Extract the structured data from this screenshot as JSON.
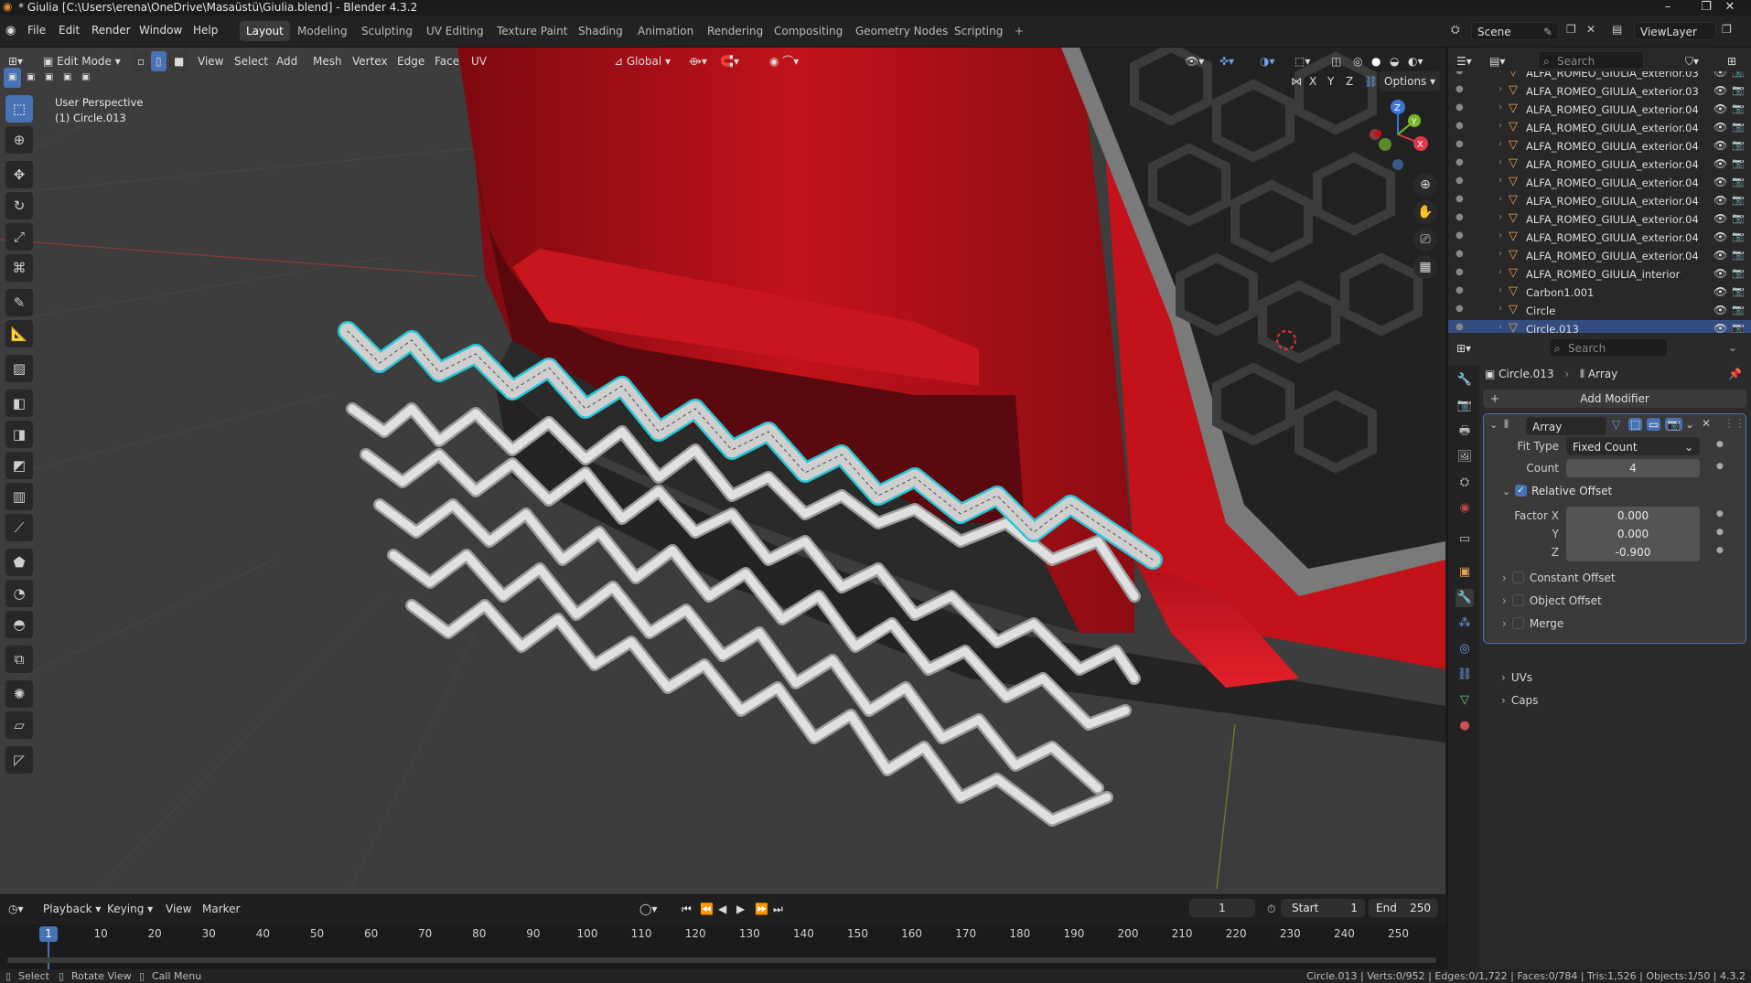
{
  "window": {
    "title": "* Giulia [C:\\Users\\erena\\OneDrive\\Masaüstü\\Giulia.blend] - Blender 4.3.2"
  },
  "menus": [
    "File",
    "Edit",
    "Render",
    "Window",
    "Help"
  ],
  "workspaces": [
    "Layout",
    "Modeling",
    "Sculpting",
    "UV Editing",
    "Texture Paint",
    "Shading",
    "Animation",
    "Rendering",
    "Compositing",
    "Geometry Nodes",
    "Scripting"
  ],
  "active_workspace": "Layout",
  "scene": {
    "label": "Scene",
    "view_layer": "ViewLayer"
  },
  "viewport": {
    "mode": "Edit Mode",
    "header_menus": [
      "View",
      "Select",
      "Add",
      "Mesh",
      "Vertex",
      "Edge",
      "Face",
      "UV"
    ],
    "orientation": "Global",
    "axes": [
      "X",
      "Y",
      "Z"
    ],
    "options": "Options",
    "overlay_text": {
      "line1": "User Perspective",
      "line2": "(1) Circle.013"
    },
    "gizmo": {
      "x": "X",
      "y": "Y",
      "z": "Z"
    }
  },
  "outliner": {
    "search_placeholder": "Search",
    "items": [
      "ALFA_ROMEO_GIULIA_exterior.03",
      "ALFA_ROMEO_GIULIA_exterior.03",
      "ALFA_ROMEO_GIULIA_exterior.04",
      "ALFA_ROMEO_GIULIA_exterior.04",
      "ALFA_ROMEO_GIULIA_exterior.04",
      "ALFA_ROMEO_GIULIA_exterior.04",
      "ALFA_ROMEO_GIULIA_exterior.04",
      "ALFA_ROMEO_GIULIA_exterior.04",
      "ALFA_ROMEO_GIULIA_exterior.04",
      "ALFA_ROMEO_GIULIA_exterior.04",
      "ALFA_ROMEO_GIULIA_exterior.04",
      "ALFA_ROMEO_GIULIA_interior",
      "Carbon1.001",
      "Circle",
      "Circle.013"
    ]
  },
  "properties": {
    "search_placeholder": "Search",
    "breadcrumb": {
      "object": "Circle.013",
      "modifier": "Array"
    },
    "add_modifier": "Add Modifier",
    "modifier": {
      "name": "Array",
      "fit_type_label": "Fit Type",
      "fit_type": "Fixed Count",
      "count_label": "Count",
      "count": "4",
      "relative_offset": "Relative Offset",
      "factor_x_label": "Factor X",
      "factor_x": "0.000",
      "y_label": "Y",
      "factor_y": "0.000",
      "z_label": "Z",
      "factor_z": "-0.900",
      "subpanels": [
        "Constant Offset",
        "Object Offset",
        "Merge",
        "UVs",
        "Caps"
      ]
    }
  },
  "timeline": {
    "menus": [
      "Playback",
      "Keying",
      "View",
      "Marker"
    ],
    "current_frame": "1",
    "start_label": "Start",
    "start": "1",
    "end_label": "End",
    "end": "250",
    "ticks": [
      "1",
      "10",
      "20",
      "30",
      "40",
      "50",
      "60",
      "70",
      "80",
      "90",
      "100",
      "110",
      "120",
      "130",
      "140",
      "150",
      "160",
      "170",
      "180",
      "190",
      "200",
      "210",
      "220",
      "230",
      "240",
      "250"
    ]
  },
  "statusbar": {
    "left": [
      "Select",
      "Rotate View",
      "Call Menu"
    ],
    "right": "Circle.013 | Verts:0/952 | Edges:0/1,722 | Faces:0/784 | Tris:1,526 | Objects:1/50 | 4.3.2"
  },
  "colors": {
    "car_red": "#c3121a",
    "selection": "#27c6d6",
    "accent": "#4772b3"
  }
}
